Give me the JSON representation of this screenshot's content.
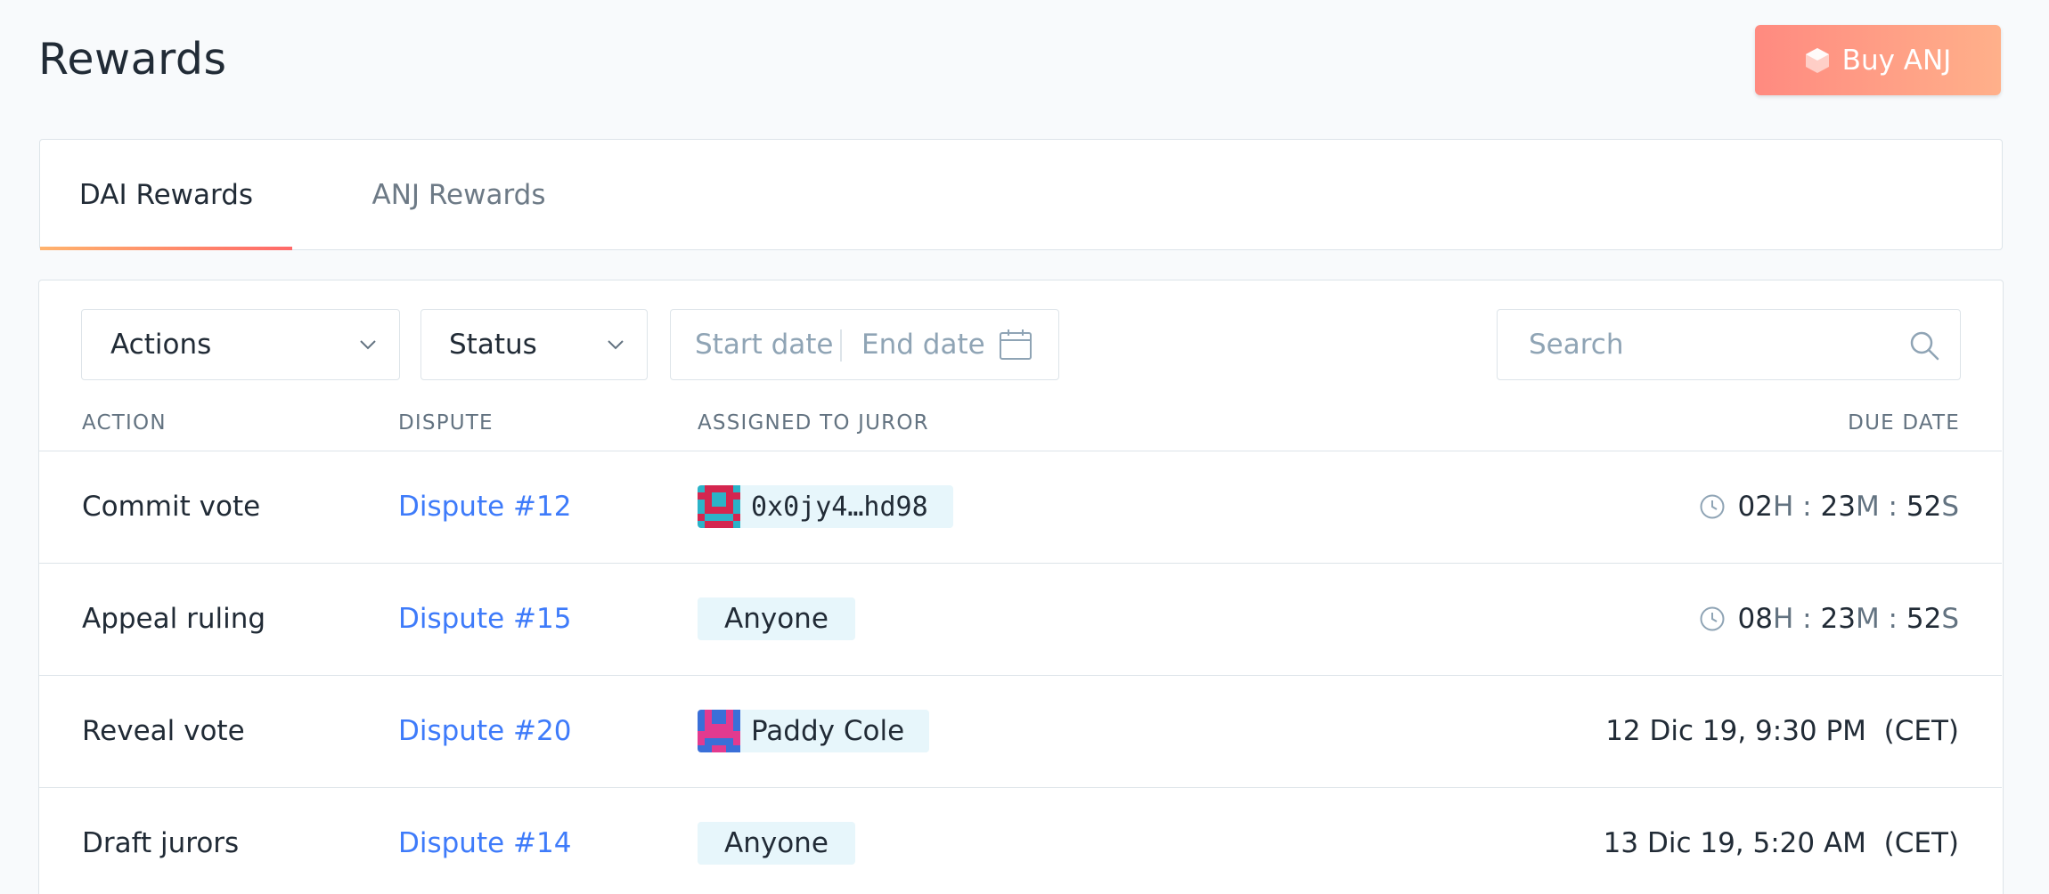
{
  "header": {
    "title": "Rewards",
    "buy_button_label": "Buy ANJ",
    "buy_button_icon": "hexagon-icon",
    "accent_gradient": [
      "#ff8a80",
      "#ffb08a"
    ]
  },
  "tabs": [
    {
      "label": "DAI Rewards",
      "active": true
    },
    {
      "label": "ANJ Rewards",
      "active": false
    }
  ],
  "filters": {
    "actions_label": "Actions",
    "status_label": "Status",
    "start_date_placeholder": "Start date",
    "end_date_placeholder": "End date",
    "search_placeholder": "Search"
  },
  "table": {
    "columns": [
      "Action",
      "Dispute",
      "Assigned to juror",
      "Due date"
    ],
    "rows": [
      {
        "action": "Commit vote",
        "dispute": "Dispute #12",
        "juror": "0x0jy4…hd98",
        "juror_type": "address",
        "due": {
          "h": "02",
          "m": "23",
          "s": "52",
          "h_unit": "H",
          "m_unit": "M",
          "s_unit": "S",
          "sep": ":"
        }
      },
      {
        "action": "Appeal ruling",
        "dispute": "Dispute #15",
        "juror": "Anyone",
        "juror_type": "anyone",
        "due": {
          "h": "08",
          "m": "23",
          "s": "52",
          "h_unit": "H",
          "m_unit": "M",
          "s_unit": "S",
          "sep": ":"
        }
      },
      {
        "action": "Reveal vote",
        "dispute": "Dispute #20",
        "juror": "Paddy Cole",
        "juror_type": "named",
        "due_text": "12 Dic 19, 9:30 PM  (CET)"
      },
      {
        "action": "Draft jurors",
        "dispute": "Dispute #14",
        "juror": "Anyone",
        "juror_type": "anyone",
        "due_text": "13 Dic 19, 5:20 AM  (CET)"
      }
    ]
  }
}
